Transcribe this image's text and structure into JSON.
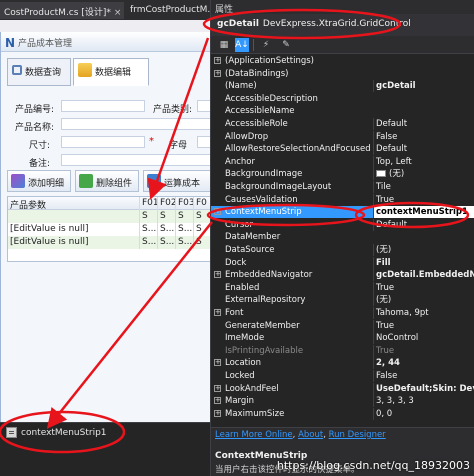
{
  "designer": {
    "tabs": [
      {
        "label": "CostProductM.cs [设计]*",
        "close": "×"
      },
      {
        "label": "frmCostProductM.cs*",
        "close": ""
      }
    ],
    "form_title": "产品成本管理",
    "logo": "N",
    "form_tabs": [
      "数据查询",
      "数据编辑"
    ],
    "fields": {
      "code": "产品编号:",
      "category": "产品类别:",
      "name": "产品名称:",
      "size": "尺寸:",
      "font": "字母",
      "note": "备注:",
      "required": "*"
    },
    "toolbar": [
      "添加明细",
      "删除组件",
      "运算成本"
    ],
    "grid": {
      "headers": [
        "产品参数",
        "F01",
        "F02",
        "F03",
        "F0"
      ],
      "rows": [
        [
          "",
          "S",
          "S",
          "S",
          "S"
        ],
        [
          "[EditValue is null]",
          "S...",
          "S...",
          "S...",
          "S"
        ],
        [
          "[EditValue is null]",
          "S...",
          "S...",
          "S...",
          "S"
        ]
      ]
    },
    "tray_item": "contextMenuStrip1"
  },
  "properties": {
    "title": "属性",
    "object_name": "gcDetail",
    "object_type": "DevExpress.XtraGrid.GridControl",
    "tool_icons": [
      "categorized-icon",
      "alphabetical-icon",
      "events-icon",
      "property-pages-icon"
    ],
    "rows": [
      {
        "expand": "+",
        "name": "(ApplicationSettings)",
        "value": ""
      },
      {
        "expand": "+",
        "name": "(DataBindings)",
        "value": ""
      },
      {
        "expand": "",
        "name": "(Name)",
        "value": "gcDetail",
        "bold": true
      },
      {
        "expand": "",
        "name": "AccessibleDescription",
        "value": ""
      },
      {
        "expand": "",
        "name": "AccessibleName",
        "value": ""
      },
      {
        "expand": "",
        "name": "AccessibleRole",
        "value": "Default"
      },
      {
        "expand": "",
        "name": "AllowDrop",
        "value": "False"
      },
      {
        "expand": "",
        "name": "AllowRestoreSelectionAndFocusedRo",
        "value": "Default"
      },
      {
        "expand": "",
        "name": "Anchor",
        "value": "Top, Left"
      },
      {
        "expand": "",
        "name": "BackgroundImage",
        "value": "(无)",
        "swatch": true
      },
      {
        "expand": "",
        "name": "BackgroundImageLayout",
        "value": "Tile"
      },
      {
        "expand": "",
        "name": "CausesValidation",
        "value": "True"
      },
      {
        "expand": "+",
        "name": "ContextMenuStrip",
        "value": "contextMenuStrip1",
        "selected": true
      },
      {
        "expand": "",
        "name": "Cursor",
        "value": "Default"
      },
      {
        "expand": "",
        "name": "DataMember",
        "value": ""
      },
      {
        "expand": "",
        "name": "DataSource",
        "value": "(无)"
      },
      {
        "expand": "",
        "name": "Dock",
        "value": "Fill",
        "bold": true
      },
      {
        "expand": "+",
        "name": "EmbeddedNavigator",
        "value": "gcDetail.EmbeddedNav",
        "bold": true
      },
      {
        "expand": "",
        "name": "Enabled",
        "value": "True"
      },
      {
        "expand": "",
        "name": "ExternalRepository",
        "value": "(无)"
      },
      {
        "expand": "+",
        "name": "Font",
        "value": "Tahoma, 9pt"
      },
      {
        "expand": "",
        "name": "GenerateMember",
        "value": "True"
      },
      {
        "expand": "",
        "name": "ImeMode",
        "value": "NoControl"
      },
      {
        "expand": "",
        "name": "IsPrintingAvailable",
        "value": "True",
        "dim": true
      },
      {
        "expand": "+",
        "name": "Location",
        "value": "2, 44",
        "bold": true
      },
      {
        "expand": "",
        "name": "Locked",
        "value": "False"
      },
      {
        "expand": "+",
        "name": "LookAndFeel",
        "value": "UseDefault;Skin: DevEx",
        "bold": true
      },
      {
        "expand": "+",
        "name": "Margin",
        "value": "3, 3, 3, 3"
      },
      {
        "expand": "+",
        "name": "MaximumSize",
        "value": "0, 0"
      }
    ],
    "links": [
      "Learn More Online",
      "About",
      "Run Designer"
    ],
    "description_title": "ContextMenuStrip",
    "description_text": "当用户右击该控件时显示的快捷菜单。"
  },
  "watermark": "https://blog.csdn.net/qq_18932003",
  "colors": {
    "annotation": "#e8141b",
    "selection": "#3399ff"
  }
}
